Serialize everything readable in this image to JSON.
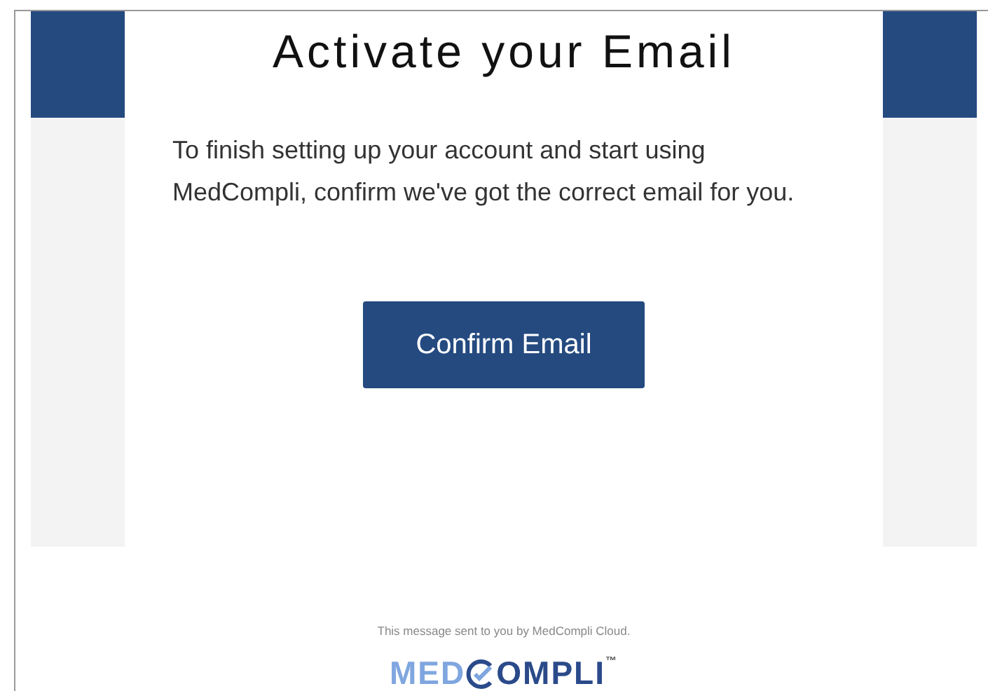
{
  "email": {
    "title": "Activate your Email",
    "message": "To finish setting up your account and start using MedCompli, confirm we've got the correct email for you.",
    "button": "Confirm Email"
  },
  "footer": {
    "note": "This message sent to you by MedCompli Cloud.",
    "logo": {
      "left": "MED",
      "right": "OMPLI",
      "mark": "™"
    }
  }
}
